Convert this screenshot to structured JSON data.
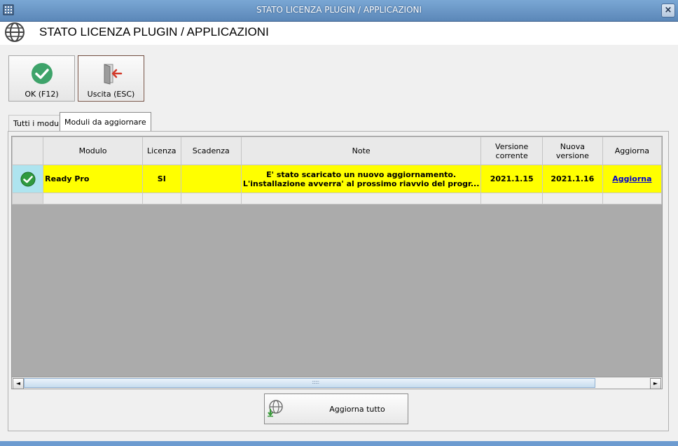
{
  "window": {
    "title": "STATO LICENZA PLUGIN / APPLICAZIONI",
    "close_glyph": "×"
  },
  "header": {
    "title": "STATO LICENZA PLUGIN / APPLICAZIONI",
    "icon": "globe-icon"
  },
  "toolbar": {
    "ok": {
      "label": "OK (F12)",
      "icon": "check-circle-icon",
      "color": "#3ea36a"
    },
    "exit": {
      "label": "Uscita (ESC)",
      "icon": "exit-door-icon",
      "color": "#d23a2a"
    }
  },
  "tabs": [
    {
      "label": "Tutti i moduli",
      "active": false
    },
    {
      "label": "Moduli da aggiornare",
      "active": true
    }
  ],
  "grid": {
    "columns": [
      "Modulo",
      "Licenza",
      "Scadenza",
      "Note",
      "Versione corrente",
      "Nuova versione",
      "Aggiorna"
    ],
    "rows": [
      {
        "status_icon": "check-circle-icon",
        "modulo": "Ready Pro",
        "licenza": "SI",
        "scadenza": "",
        "note_line1": "E' stato scaricato un nuovo aggiornamento.",
        "note_line2": "L'installazione avverra' al prossimo riavvio del progr...",
        "versione_corrente": "2021.1.15",
        "nuova_versione": "2021.1.16",
        "aggiorna": "Aggiorna"
      }
    ],
    "selected_row_color": "#ffff00"
  },
  "scrollbar": {
    "left_arrow": "◄",
    "right_arrow": "►",
    "grip": "::::::"
  },
  "footer": {
    "update_all_label": "Aggiorna tutto",
    "icon": "globe-download-icon"
  }
}
